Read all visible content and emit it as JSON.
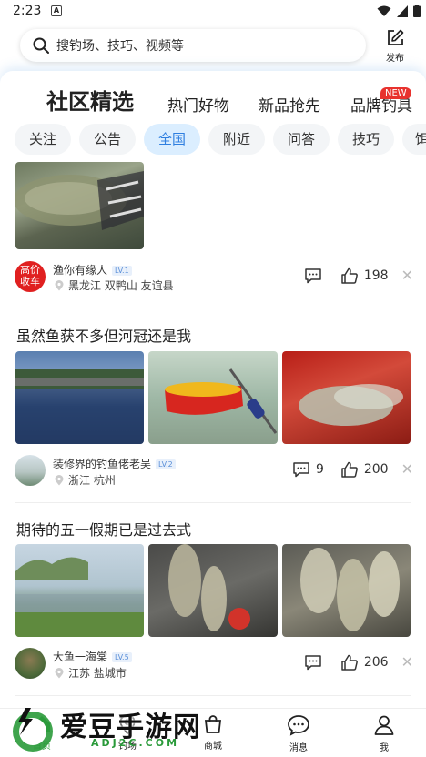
{
  "status_bar": {
    "time": "2:23",
    "notif_icon": "A"
  },
  "search": {
    "placeholder": "搜钓场、技巧、视频等"
  },
  "publish": {
    "label": "发布"
  },
  "category_tabs": [
    {
      "label": "社区精选",
      "active": true
    },
    {
      "label": "热门好物"
    },
    {
      "label": "新品抢先"
    },
    {
      "label": "品牌钓具",
      "badge": "NEW"
    }
  ],
  "filter_chips": [
    "关注",
    "公告",
    "全国",
    "附近",
    "问答",
    "技巧",
    "饵"
  ],
  "active_chip": "全国",
  "posts": [
    {
      "avatar_text": [
        "高价",
        "收车"
      ],
      "user": "渔你有缘人",
      "level": "LV.1",
      "location": "黑龙江 双鸭山 友谊县",
      "comments": "",
      "likes": "198"
    },
    {
      "title": "虽然鱼获不多但河冠还是我",
      "user": "装修界的钓鱼佬老吴",
      "level": "LV.2",
      "location": "浙江 杭州",
      "comments": "9",
      "likes": "200"
    },
    {
      "title": "期待的五一假期已是过去式",
      "user": "大鱼一海棠",
      "level": "LV.5",
      "location": "江苏 盐城市",
      "comments": "",
      "likes": "206"
    }
  ],
  "bottom_nav": [
    {
      "label": "首页",
      "icon": "home-icon",
      "active": true
    },
    {
      "label": "钓场",
      "icon": "location-icon"
    },
    {
      "label": "商城",
      "icon": "shop-icon"
    },
    {
      "label": "消息",
      "icon": "message-icon"
    },
    {
      "label": "我",
      "icon": "user-icon"
    }
  ],
  "watermark": {
    "text": "爱豆手游网",
    "url": "ADJ2C.COM"
  },
  "colors": {
    "accent_blue": "#2f7fe0",
    "chip_active_bg": "#dbeeff",
    "badge_red": "#e8322e",
    "nav_active": "#3aa348"
  }
}
